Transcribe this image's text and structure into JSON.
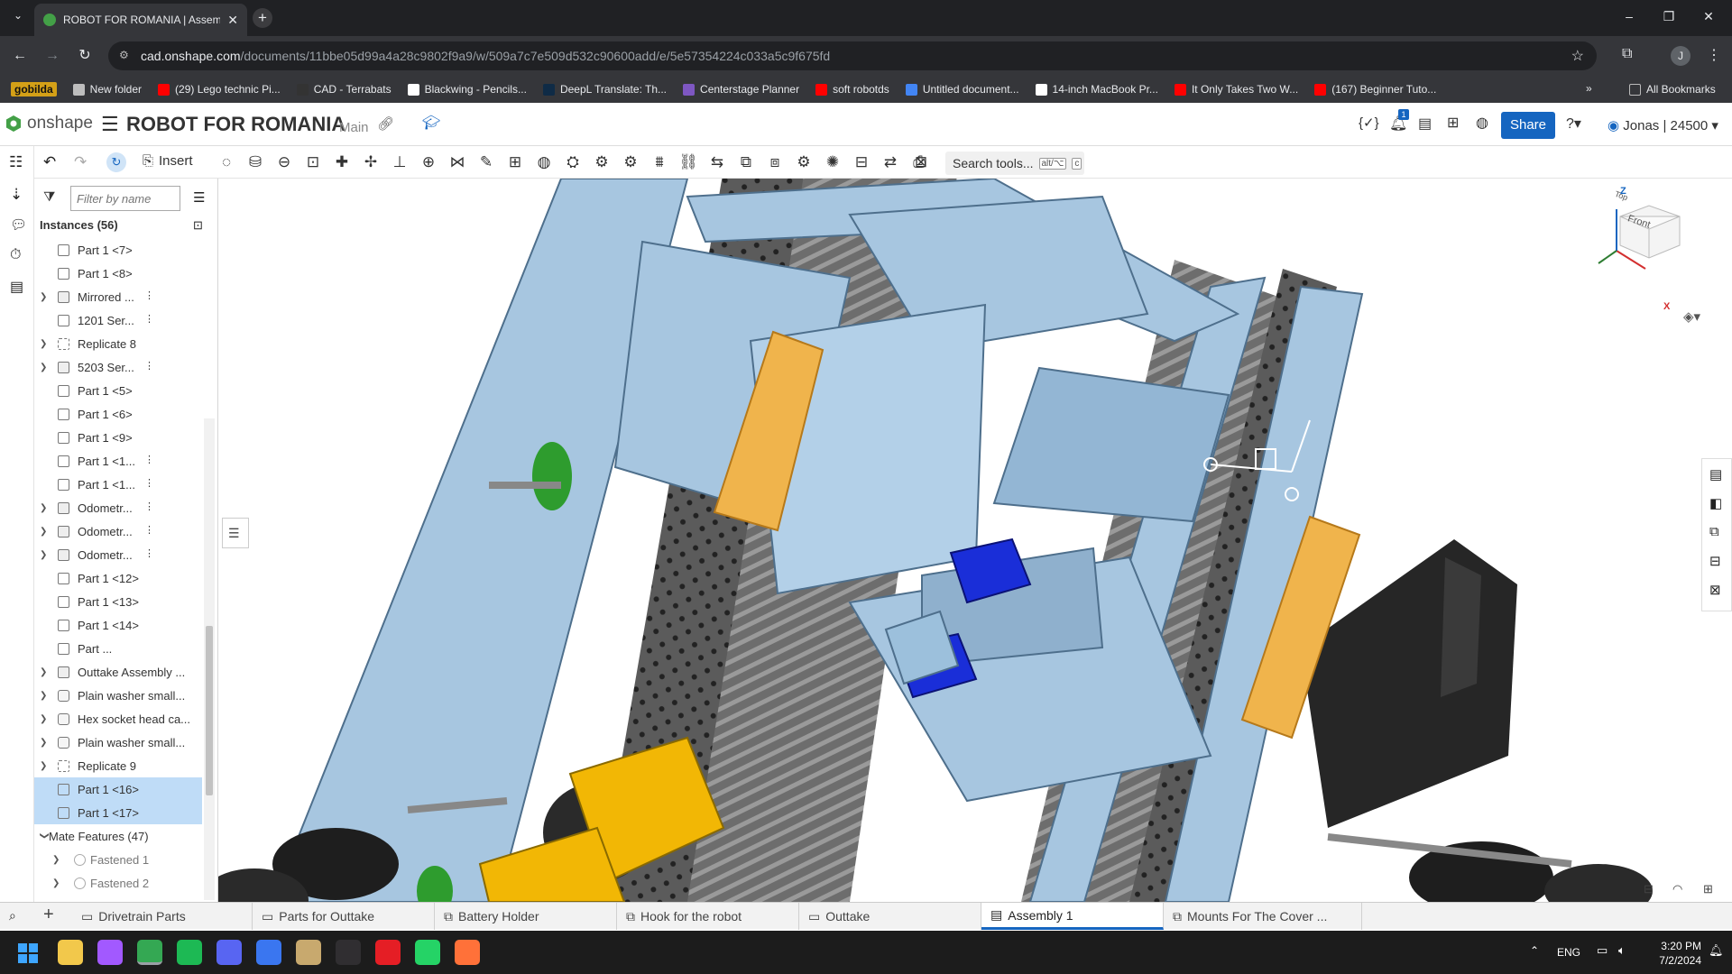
{
  "browser": {
    "tab_title": "ROBOT FOR ROMANIA | Assem",
    "url_host": "cad.onshape.com",
    "url_path": "/documents/11bbe05d99a4a28c9802f9a9/w/509a7c7e509d532c90600add/e/5e57354224c033a5c9f675fd",
    "bookmarks": [
      {
        "label": "gobilda",
        "color": "#d4a017"
      },
      {
        "label": "New folder",
        "color": "#bdbdbd"
      },
      {
        "label": "(29) Lego technic Pi...",
        "color": "#ff0000"
      },
      {
        "label": "CAD - Terrabats",
        "color": "#333333"
      },
      {
        "label": "Blackwing - Pencils...",
        "color": "#ffffff"
      },
      {
        "label": "DeepL Translate: Th...",
        "color": "#0f2b46"
      },
      {
        "label": "Centerstage Planner",
        "color": "#7e57c2"
      },
      {
        "label": "soft robotds",
        "color": "#ff0000"
      },
      {
        "label": "Untitled document...",
        "color": "#4285f4"
      },
      {
        "label": "14-inch MacBook Pr...",
        "color": "#ffffff"
      },
      {
        "label": "It Only Takes Two W...",
        "color": "#ff0000"
      },
      {
        "label": "(167) Beginner Tuto...",
        "color": "#ff0000"
      }
    ],
    "all_bookmarks": "All Bookmarks",
    "profile_initial": "J"
  },
  "onshape": {
    "logo_text": "onshape",
    "doc_title": "ROBOT FOR ROMANIA",
    "branch": "Main",
    "notif_count": "1",
    "share_label": "Share",
    "user_label": "Jonas | 24500",
    "insert_label": "Insert",
    "search_tools": "Search tools...",
    "search_kbd": "alt/⌥",
    "search_key": "c",
    "filter_placeholder": "Filter by name",
    "instances_header": "Instances (56)",
    "instances": [
      {
        "label": "Part 1 <7>",
        "kind": "part",
        "expand": false,
        "marker": false,
        "selected": false
      },
      {
        "label": "Part 1 <8>",
        "kind": "part",
        "expand": false,
        "marker": false,
        "selected": false
      },
      {
        "label": "Mirrored ...",
        "kind": "asm",
        "expand": true,
        "marker": true,
        "selected": false
      },
      {
        "label": "1201 Ser...",
        "kind": "part",
        "expand": false,
        "marker": true,
        "selected": false
      },
      {
        "label": "Replicate 8",
        "kind": "rep",
        "expand": true,
        "marker": false,
        "selected": false
      },
      {
        "label": "5203 Ser...",
        "kind": "asm",
        "expand": true,
        "marker": true,
        "selected": false
      },
      {
        "label": "Part 1 <5>",
        "kind": "part",
        "expand": false,
        "marker": false,
        "selected": false
      },
      {
        "label": "Part 1 <6>",
        "kind": "part",
        "expand": false,
        "marker": false,
        "selected": false
      },
      {
        "label": "Part 1 <9>",
        "kind": "part",
        "expand": false,
        "marker": false,
        "selected": false
      },
      {
        "label": "Part 1 <1...",
        "kind": "part",
        "expand": false,
        "marker": true,
        "selected": false
      },
      {
        "label": "Part 1 <1...",
        "kind": "part",
        "expand": false,
        "marker": true,
        "selected": false
      },
      {
        "label": "Odometr...",
        "kind": "asm",
        "expand": true,
        "marker": true,
        "selected": false
      },
      {
        "label": "Odometr...",
        "kind": "asm",
        "expand": true,
        "marker": true,
        "selected": false
      },
      {
        "label": "Odometr...",
        "kind": "asm",
        "expand": true,
        "marker": true,
        "selected": false
      },
      {
        "label": "Part 1 <12>",
        "kind": "part",
        "expand": false,
        "marker": false,
        "selected": false
      },
      {
        "label": "Part 1 <13>",
        "kind": "part",
        "expand": false,
        "marker": false,
        "selected": false
      },
      {
        "label": "Part 1 <14>",
        "kind": "part",
        "expand": false,
        "marker": false,
        "selected": false
      },
      {
        "label": "Part ...",
        "kind": "part",
        "expand": false,
        "marker": false,
        "selected": false
      },
      {
        "label": "Outtake Assembly ...",
        "kind": "asm",
        "expand": true,
        "marker": false,
        "selected": false
      },
      {
        "label": "Plain washer small...",
        "kind": "std",
        "expand": true,
        "marker": false,
        "selected": false
      },
      {
        "label": "Hex socket head ca...",
        "kind": "std",
        "expand": true,
        "marker": false,
        "selected": false
      },
      {
        "label": "Plain washer small...",
        "kind": "std",
        "expand": true,
        "marker": false,
        "selected": false
      },
      {
        "label": "Replicate 9",
        "kind": "rep",
        "expand": true,
        "marker": false,
        "selected": false
      },
      {
        "label": "Part 1 <16>",
        "kind": "part",
        "expand": false,
        "marker": false,
        "selected": true
      },
      {
        "label": "Part 1 <17>",
        "kind": "part",
        "expand": false,
        "marker": false,
        "selected": true
      }
    ],
    "mate_header": "Mate Features (47)",
    "mates": [
      "Fastened 1",
      "Fastened 2"
    ],
    "viewcube_top": "Top",
    "viewcube_front": "Front",
    "axis_z": "Z",
    "axis_x": "X",
    "bottom_tabs": [
      {
        "label": "Drivetrain Parts",
        "type": "folder",
        "active": false
      },
      {
        "label": "Parts for Outtake",
        "type": "folder",
        "active": false
      },
      {
        "label": "Battery Holder",
        "type": "part",
        "active": false
      },
      {
        "label": "Hook for the robot",
        "type": "part",
        "active": false
      },
      {
        "label": "Outtake",
        "type": "folder",
        "active": false
      },
      {
        "label": "Assembly 1",
        "type": "asm",
        "active": true
      },
      {
        "label": "Mounts For The Cover ...",
        "type": "part",
        "active": false
      }
    ]
  },
  "taskbar": {
    "time": "3:20 PM",
    "date": "7/2/2024",
    "lang": "ENG",
    "apps": [
      {
        "name": "file-explorer-icon",
        "color": "#f2c84b"
      },
      {
        "name": "messenger-icon",
        "color": "#a259ff"
      },
      {
        "name": "chrome-icon",
        "color": "#34a853"
      },
      {
        "name": "spotify-icon",
        "color": "#1db954"
      },
      {
        "name": "discord-icon",
        "color": "#5865f2"
      },
      {
        "name": "signal-icon",
        "color": "#3a76f0"
      },
      {
        "name": "photos-icon",
        "color": "#c8a96e"
      },
      {
        "name": "obs-icon",
        "color": "#302e31"
      },
      {
        "name": "autodesk-icon",
        "color": "#e51e25"
      },
      {
        "name": "whatsapp-icon",
        "color": "#25d366"
      },
      {
        "name": "firefox-icon",
        "color": "#ff7139"
      }
    ]
  },
  "colors": {
    "part_blue": "#a7c6e0",
    "part_blue_dark": "#7fa5c6",
    "highlight_orange": "#f0b44c",
    "motor_yellow": "#f2b705",
    "dark_grey": "#3a3a3a",
    "accent": "#1565c0"
  }
}
